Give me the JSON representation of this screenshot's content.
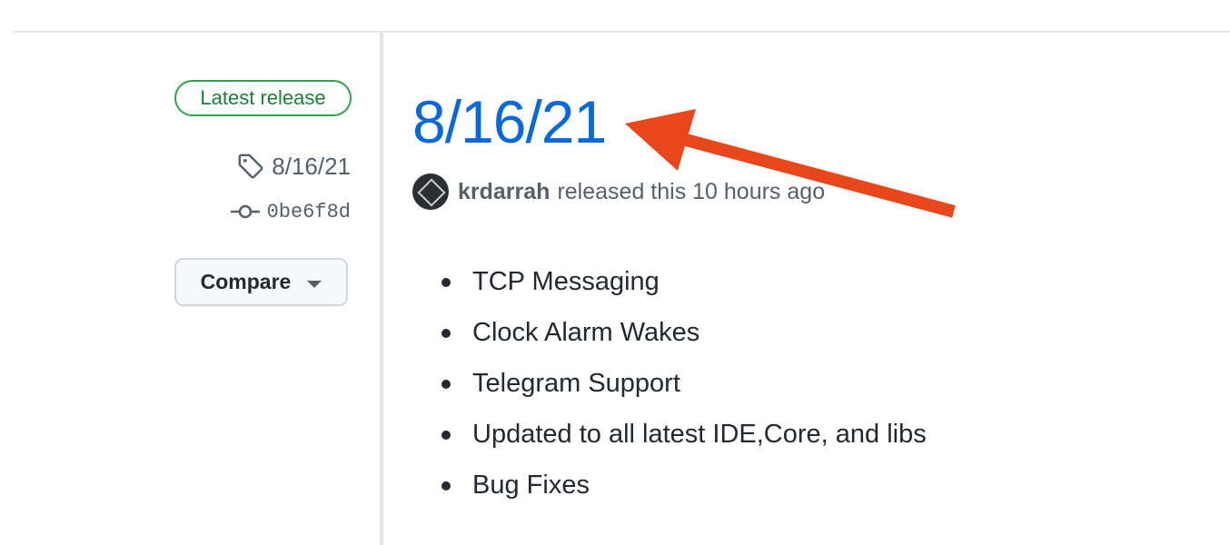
{
  "sidebar": {
    "badge": "Latest release",
    "tag": "8/16/21",
    "commit": "0be6f8d",
    "compare_label": "Compare"
  },
  "release": {
    "title": "8/16/21",
    "author": "krdarrah",
    "released_text": "released this 10 hours ago",
    "notes": [
      "TCP Messaging",
      "Clock Alarm Wakes",
      "Telegram Support",
      "Updated to all latest IDE,Core, and libs",
      "Bug Fixes"
    ]
  },
  "colors": {
    "accent_link": "#0969da",
    "badge_green": "#1a7f37",
    "annotation_arrow": "#e8471c"
  },
  "icons": [
    "tag-icon",
    "git-commit-icon",
    "triangle-down-icon",
    "annotation-arrow"
  ]
}
